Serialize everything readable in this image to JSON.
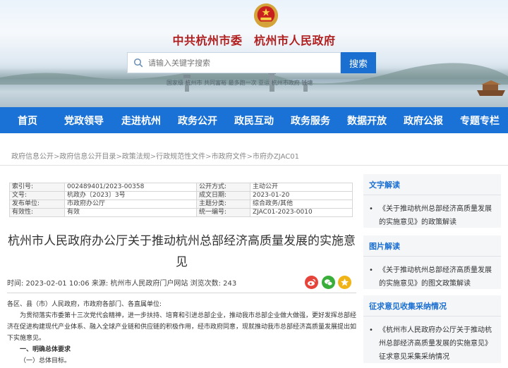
{
  "header": {
    "site_title": "中共杭州市委　杭州市人民政府",
    "search_placeholder": "请输入关键字搜索",
    "search_button": "搜索",
    "hot_words": "国家级  杭州市  共同富裕  最多跑一次  亚运  杭州市政府  钱塘"
  },
  "nav": [
    "首页",
    "党政领导",
    "走进杭州",
    "政务公开",
    "政民互动",
    "政务服务",
    "数据开放",
    "政府公报",
    "专题专栏"
  ],
  "breadcrumb": [
    "政府信息公开",
    "政府信息公开目录",
    "政策法规",
    "行政规范性文件",
    "市政府文件",
    "市府办ZJAC01"
  ],
  "info_table": [
    [
      "索引号:",
      "002489401/2023-00358",
      "公开方式:",
      "主动公开"
    ],
    [
      "文号:",
      "杭政办〔2023〕3号",
      "成文日期:",
      "2023-01-20"
    ],
    [
      "发布单位:",
      "市政府办公厅",
      "主题分类:",
      "综合政务/其他"
    ],
    [
      "有效性:",
      "有效",
      "统一编号:",
      "ZJAC01-2023-0010"
    ]
  ],
  "document": {
    "title_line1": "杭州市人民政府办公厅关于推动杭州总部经济高质量发展的实施意",
    "title_line2": "见",
    "meta": "时间: 2023-02-01 10:06   来源: 杭州市人民政府门户网站   浏览次数: 243",
    "salutation": "各区、县（市）人民政府，市政府各部门、各直属单位:",
    "paragraph": "为贯彻落实市委第十三次党代会精神，进一步扶持、培育和引进总部企业，推动我市总部企业做大做强，更好发挥总部经济在促进构建现代产业体系、融入全球产业链和供应链的积极作用，经市政府同意，现就推动我市总部经济高质量发展提出如下实施意见。",
    "section1": "一、明确总体要求",
    "section1_1": "（一）总体目标。"
  },
  "sidebar": [
    {
      "heading": "文字解读",
      "text": "《关于推动杭州总部经济高质量发展的实施意见》的政策解读"
    },
    {
      "heading": "图片解读",
      "text": "《关于推动杭州总部经济高质量发展的实施意见》的图文政策解读"
    },
    {
      "heading": "征求意见收集采纳情况",
      "text": "《杭州市人民政府办公厅关于推动杭州总部经济高质量发展的实施意见》征求意见采集采纳情况"
    }
  ],
  "colors": {
    "nav": "#1a72d6",
    "title_red": "#b01f1f",
    "accent": "#1b6fd0"
  }
}
